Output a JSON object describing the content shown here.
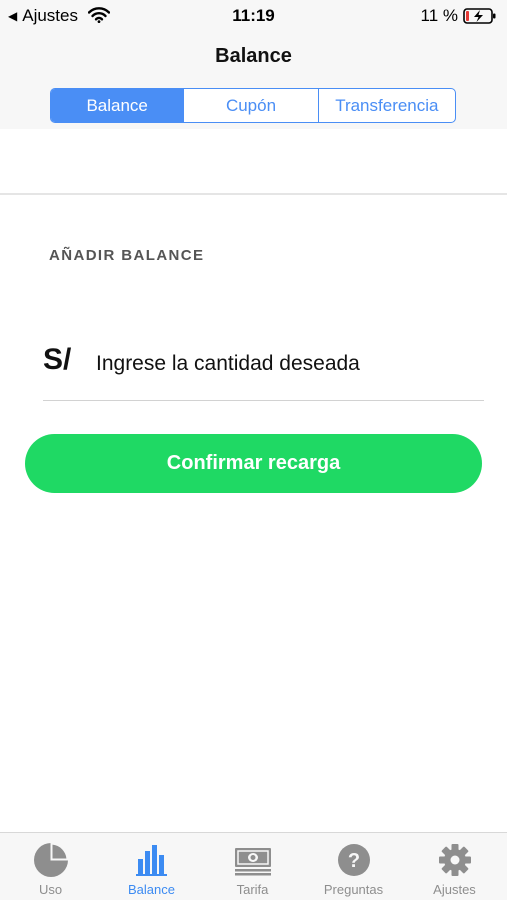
{
  "status_bar": {
    "back_label": "Ajustes",
    "time": "11:19",
    "battery_percent": "11 %"
  },
  "header": {
    "title": "Balance"
  },
  "segments": [
    {
      "label": "Balance",
      "active": true
    },
    {
      "label": "Cupón",
      "active": false
    },
    {
      "label": "Transferencia",
      "active": false
    }
  ],
  "form": {
    "section_title": "AÑADIR BALANCE",
    "currency_symbol": "S/",
    "amount_placeholder": "Ingrese la cantidad deseada",
    "amount_value": ""
  },
  "confirm_label": "Confirmar recarga",
  "tab_bar": {
    "items": [
      {
        "label": "Uso",
        "icon": "pie-chart-icon",
        "active": false
      },
      {
        "label": "Balance",
        "icon": "bar-chart-icon",
        "active": true
      },
      {
        "label": "Tarifa",
        "icon": "banknote-icon",
        "active": false
      },
      {
        "label": "Preguntas",
        "icon": "question-icon",
        "active": false
      },
      {
        "label": "Ajustes",
        "icon": "gear-icon",
        "active": false
      }
    ]
  },
  "colors": {
    "accent": "#4a8ef5",
    "confirm_green": "#1fd964",
    "tab_active": "#3c8bf2",
    "tab_inactive": "#8e8e8e"
  }
}
